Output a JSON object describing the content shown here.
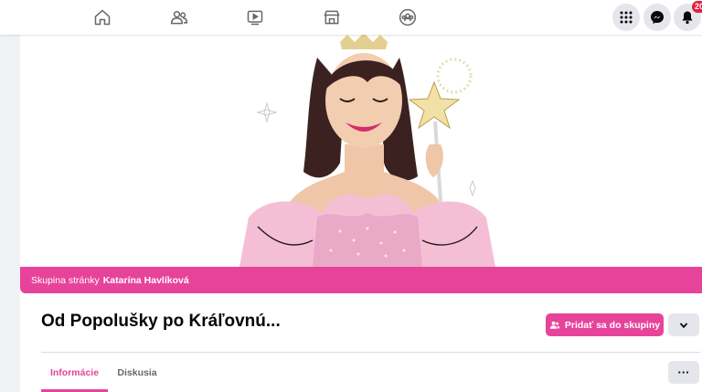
{
  "nav": {
    "tabs": [
      "home-icon",
      "friends-icon",
      "watch-icon",
      "marketplace-icon",
      "groups-icon"
    ],
    "right": [
      "menu-grid-icon",
      "messenger-icon",
      "bell-icon"
    ],
    "notification_count": "20"
  },
  "group": {
    "banner_prefix": "Skupina stránky",
    "banner_owner": "Katarína Havlíková",
    "title": "Od Popolušky po Kráľovnú...",
    "join_label": "Pridať sa do skupiny",
    "more_label": "···"
  },
  "tabs": {
    "info": "Informácie",
    "discussion": "Diskusia"
  },
  "colors": {
    "accent": "#e8439a",
    "badge": "#e41e3f"
  }
}
